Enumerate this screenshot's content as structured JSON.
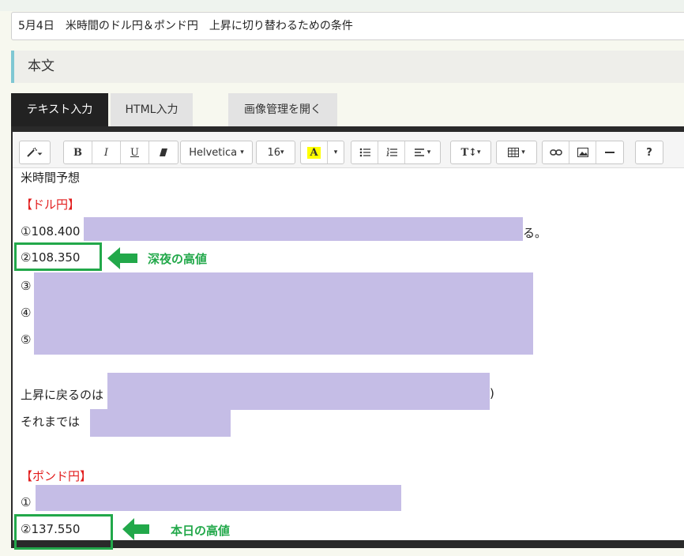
{
  "title_input": {
    "value": "5月4日　米時間のドル円＆ポンド円　上昇に切り替わるための条件"
  },
  "section": {
    "heading": "本文"
  },
  "tabs": [
    {
      "label": "テキスト入力",
      "active": true
    },
    {
      "label": "HTML入力",
      "active": false
    },
    {
      "label": "画像管理を開く",
      "active": false
    }
  ],
  "toolbar": {
    "font_family": "Helvetica",
    "font_size": "16",
    "color_letter": "A",
    "text_size_label": "T↕",
    "help_label": "?",
    "icons": [
      "magic-wand-icon",
      "bold-icon",
      "italic-icon",
      "underline-icon",
      "eraser-icon",
      "font-color-icon",
      "bulleted-list-icon",
      "numbered-list-icon",
      "align-icon",
      "text-size-icon",
      "table-icon",
      "link-icon",
      "image-icon",
      "horizontal-rule-icon",
      "help-icon"
    ]
  },
  "body": {
    "line_heading": "米時間予想",
    "dollar_yen_label": "【ドル円】",
    "dy_item1_prefix": "①108.400",
    "dy_item1_suffix": "る。",
    "dy_item2": "②108.350",
    "dy_item3_marker": "③",
    "dy_item4_marker": "④",
    "dy_item5_marker": "⑤",
    "return_line_prefix": "上昇に戻るのは",
    "return_line_suffix": ")",
    "until_then": "それまでは",
    "pound_yen_label": "【ポンド円】",
    "py_item1_marker": "①",
    "py_item2": "②137.550"
  },
  "annotations": {
    "night_high": "深夜の高値",
    "today_high": "本日の高値"
  },
  "colors": {
    "highlight_box": "#22a84a",
    "redaction": "#c5bde6",
    "label_red": "#e21d1d"
  }
}
